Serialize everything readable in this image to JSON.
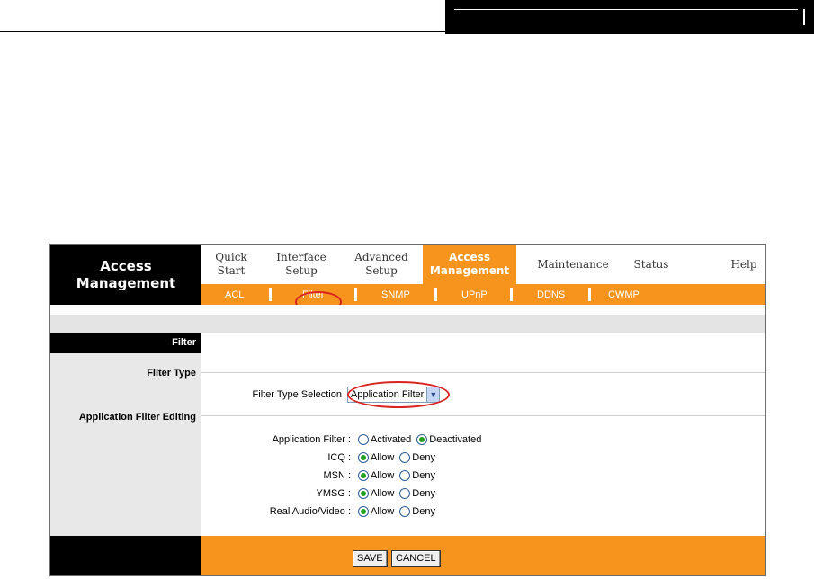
{
  "brand": {
    "line1": "Access",
    "line2": "Management"
  },
  "topnav": [
    {
      "label": "Quick\nStart",
      "active": false
    },
    {
      "label": "Interface\nSetup",
      "active": false
    },
    {
      "label": "Advanced\nSetup",
      "active": false
    },
    {
      "label": "Access\nManagement",
      "active": true
    },
    {
      "label": "Maintenance",
      "active": false
    },
    {
      "label": "Status",
      "active": false
    },
    {
      "label": "Help",
      "active": false
    }
  ],
  "subnav": [
    {
      "label": "ACL",
      "active": false
    },
    {
      "label": "Filter",
      "active": true
    },
    {
      "label": "SNMP",
      "active": false
    },
    {
      "label": "UPnP",
      "active": false
    },
    {
      "label": "DDNS",
      "active": false
    },
    {
      "label": "CWMP",
      "active": false
    }
  ],
  "section": {
    "title": "Filter",
    "filter_type_label": "Filter Type",
    "app_filter_editing_label": "Application Filter Editing"
  },
  "filter_type": {
    "label": "Filter Type Selection",
    "selected": "Application Filter"
  },
  "app_filter": {
    "label": "Application Filter :",
    "options": [
      "Activated",
      "Deactivated"
    ],
    "selected": "Deactivated"
  },
  "services": [
    {
      "label": "ICQ :",
      "options": [
        "Allow",
        "Deny"
      ],
      "selected": "Allow"
    },
    {
      "label": "MSN :",
      "options": [
        "Allow",
        "Deny"
      ],
      "selected": "Allow"
    },
    {
      "label": "YMSG :",
      "options": [
        "Allow",
        "Deny"
      ],
      "selected": "Allow"
    },
    {
      "label": "Real Audio/Video :",
      "options": [
        "Allow",
        "Deny"
      ],
      "selected": "Allow"
    }
  ],
  "buttons": {
    "save": "SAVE",
    "cancel": "CANCEL"
  },
  "colors": {
    "accent": "#f7941d",
    "highlight_circle": "#d8231e"
  }
}
